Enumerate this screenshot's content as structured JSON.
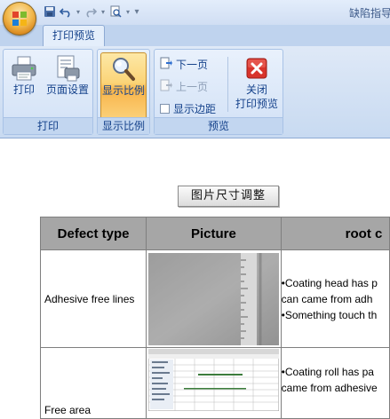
{
  "window": {
    "title": "缺陷指导"
  },
  "quick_access": {
    "items": [
      "save-icon",
      "undo-icon",
      "redo-icon",
      "print-preview-icon",
      "customize-icon"
    ]
  },
  "tabs": [
    {
      "label": "打印预览",
      "active": true
    }
  ],
  "ribbon": {
    "groups": [
      {
        "label": "打印",
        "buttons": [
          {
            "label": "打印",
            "icon": "printer-icon"
          },
          {
            "label": "页面设置",
            "icon": "page-setup-icon"
          }
        ]
      },
      {
        "label": "显示比例",
        "buttons": [
          {
            "label": "显示比例",
            "icon": "zoom-icon",
            "active": true
          }
        ]
      },
      {
        "label": "预览",
        "small_buttons": [
          {
            "label": "下一页",
            "icon": "next-page-icon",
            "enabled": true
          },
          {
            "label": "上一页",
            "icon": "previous-page-icon",
            "enabled": false
          },
          {
            "label": "显示边距",
            "checkbox": true,
            "checked": false
          }
        ],
        "buttons": [
          {
            "label": "关闭\n打印预览",
            "line1": "关闭",
            "line2": "打印预览",
            "icon": "close-preview-icon"
          }
        ]
      }
    ]
  },
  "document": {
    "button_label": "图片尺寸调整",
    "table": {
      "headers": [
        "Defect type",
        "Picture",
        "root c"
      ],
      "rows": [
        {
          "defect_type": "Adhesive free lines",
          "causes": [
            "•Coating head has p",
            "can came from adh",
            "•Something touch th"
          ]
        },
        {
          "defect_type": "Free area",
          "causes": [
            "•Coating roll has pa",
            "came from adhesive"
          ]
        }
      ]
    }
  },
  "colors": {
    "ribbon_bg": "#dfe9f7",
    "ribbon_text": "#15428b",
    "active_button": "#fbd478",
    "table_header": "#a6a6a6"
  }
}
